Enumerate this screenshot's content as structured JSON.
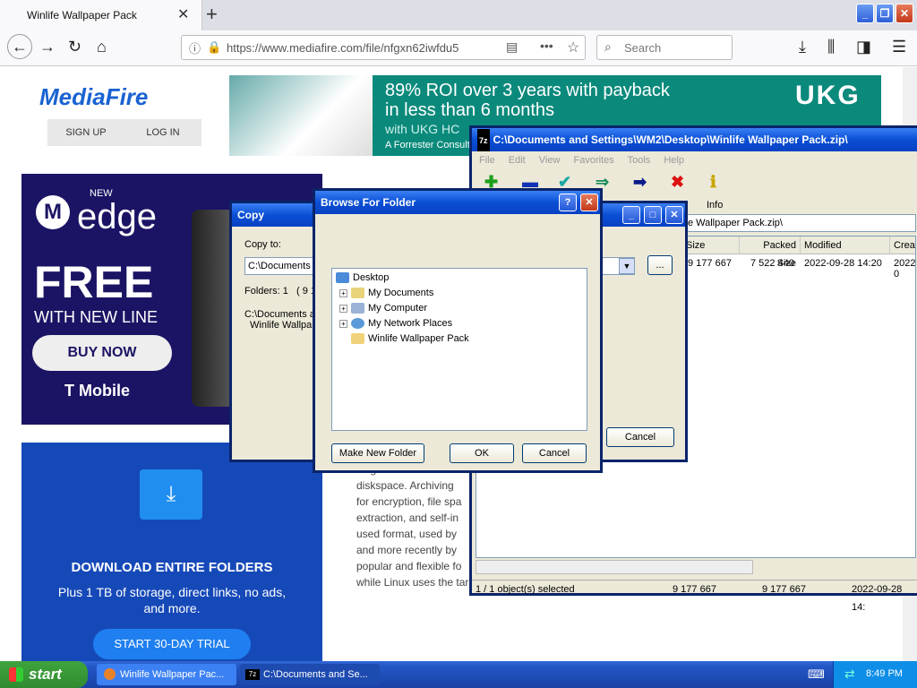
{
  "browser": {
    "tab_title": "Winlife Wallpaper Pack",
    "tab_close": "✕",
    "new_tab": "+",
    "url": "https://www.mediafire.com/file/nfgxn62iwfdu5",
    "search_placeholder": "Search",
    "window_controls": {
      "minimize": "_",
      "restore": "❐",
      "close": "✕"
    }
  },
  "mediafire": {
    "logo": "MediaFire",
    "sign_up": "SIGN UP",
    "log_in": "LOG IN"
  },
  "ad_top": {
    "headline": "89% ROI over 3 years with payback in less than 6 months",
    "sub": "with UKG HC",
    "source": "A Forrester Consult",
    "brand": "UKG"
  },
  "ad_left": {
    "new": "NEW",
    "product": "edge",
    "free": "FREE",
    "with_line": "WITH NEW LINE",
    "buy": "BUY NOW",
    "carrier": "T Mobile"
  },
  "promo": {
    "heading": "DOWNLOAD ENTIRE FOLDERS",
    "body": "Plus 1 TB of storage, direct links, no ads, and more.",
    "cta": "START 30-DAY TRIAL"
  },
  "article_lines": [
    "single file to make the",
    "diskspace. Archiving",
    "for encryption, file spa",
    "extraction, and self-in",
    "used format, used by",
    "and more recently by",
    "popular and flexible fo",
    "while Linux uses the tar and gz format."
  ],
  "sevenzip": {
    "title": "C:\\Documents and Settings\\WM2\\Desktop\\Winlife Wallpaper Pack.zip\\",
    "menu": [
      "File",
      "Edit",
      "View",
      "Favorites",
      "Tools",
      "Help"
    ],
    "toolbar_info": "Info",
    "address": "C:\\Documents and Settings\\WM2\\Desktop\\Winlife Wallpaper Pack.zip\\",
    "columns": [
      "Size",
      "Packed Size",
      "Modified",
      "Create"
    ],
    "row": {
      "size": "9 177 667",
      "packed": "7 522 440",
      "modified": "2022-09-28 14:20",
      "created": "2022-0"
    },
    "status": {
      "selected": "1 / 1 object(s) selected",
      "size": "9 177 667",
      "packed": "9 177 667",
      "date": "2022-09-28 14:"
    }
  },
  "copy_dialog": {
    "title": "Copy",
    "copy_to_label": "Copy to:",
    "copy_to_value": "C:\\Documents and Settings\\WM2\\Desktop\\Winlife Wallpaper Pack\\",
    "folders": "Folders: 1",
    "files": "( 9 1",
    "path_line1": "C:\\Documents a",
    "path_line2": "Winlife Wallpap",
    "browse": "...",
    "cancel": "Cancel"
  },
  "browse_dialog": {
    "title": "Browse For Folder",
    "tree": [
      "Desktop",
      "My Documents",
      "My Computer",
      "My Network Places",
      "Winlife Wallpaper Pack"
    ],
    "make_new_folder": "Make New Folder",
    "ok": "OK",
    "cancel": "Cancel"
  },
  "taskbar": {
    "start": "start",
    "items": [
      "Winlife Wallpaper Pac...",
      "C:\\Documents and Se..."
    ],
    "clock": "8:49 PM"
  }
}
